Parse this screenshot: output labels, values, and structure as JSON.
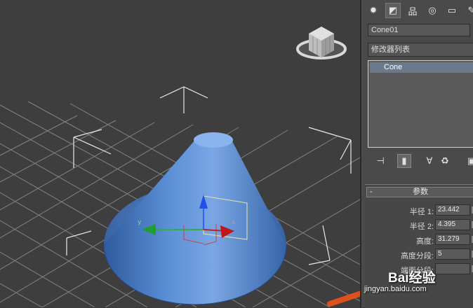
{
  "viewport": {
    "gizmo": {
      "x_label": "x",
      "y_label": "y",
      "z_label": "z"
    }
  },
  "command_panel": {
    "tabs": [
      {
        "icon": "create-icon"
      },
      {
        "icon": "modify-icon"
      },
      {
        "icon": "hierarchy-icon"
      },
      {
        "icon": "motion-icon"
      },
      {
        "icon": "display-icon"
      },
      {
        "icon": "utilities-icon"
      }
    ],
    "object_name": "Cone01",
    "modifier_list": "修改器列表",
    "stack": {
      "items": [
        "Cone"
      ]
    },
    "tools": [
      {
        "icon": "pin-stack-icon"
      },
      {
        "icon": "show-end-result-icon"
      },
      {
        "icon": "make-unique-icon"
      },
      {
        "icon": "remove-modifier-icon"
      },
      {
        "icon": "configure-sets-icon"
      }
    ],
    "rollout": {
      "sign": "-",
      "title": "参数",
      "params": [
        {
          "label": "半径 1:",
          "value": "23.442"
        },
        {
          "label": "半径 2:",
          "value": "4.395"
        },
        {
          "label": "高度:",
          "value": "31.279"
        },
        {
          "label": "高度分段:",
          "value": "5"
        },
        {
          "label": "端面分段:",
          "value": ""
        }
      ]
    }
  },
  "watermark": {
    "logo": "Bai经验",
    "url": "jingyan.baidu.com"
  },
  "colors": {
    "cone": "#4f7fc6",
    "grid": "#8a8a8a",
    "viewport_bg": "#3e3e3e",
    "arrow": "#e0501c"
  }
}
